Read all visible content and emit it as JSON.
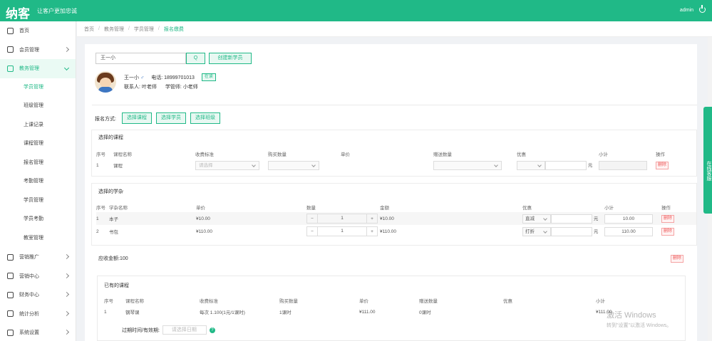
{
  "topbar": {
    "logo": "纳客",
    "slogan": "让客户更加忠诚",
    "user": "admin"
  },
  "sidebar": {
    "items": [
      {
        "label": "首页",
        "icon": "home-icon",
        "has_arrow": false
      },
      {
        "label": "会员管理",
        "icon": "member-icon",
        "has_arrow": true
      },
      {
        "label": "教务管理",
        "icon": "book-icon",
        "has_arrow": true,
        "active": true
      },
      {
        "label": "营销推广",
        "icon": "marketing-icon",
        "has_arrow": true
      },
      {
        "label": "营销中心",
        "icon": "center-icon",
        "has_arrow": true
      },
      {
        "label": "财务中心",
        "icon": "finance-icon",
        "has_arrow": true
      },
      {
        "label": "统计分析",
        "icon": "stats-icon",
        "has_arrow": true
      },
      {
        "label": "系统设置",
        "icon": "settings-icon",
        "has_arrow": true
      }
    ],
    "sub_items": [
      {
        "label": "学员管理",
        "active": true
      },
      {
        "label": "班级管理"
      },
      {
        "label": "上课记录"
      },
      {
        "label": "课程管理"
      },
      {
        "label": "报名管理"
      },
      {
        "label": "考勤管理"
      },
      {
        "label": "学员管理"
      },
      {
        "label": "学员考勤"
      },
      {
        "label": "教室管理"
      }
    ]
  },
  "breadcrumb": [
    "首页",
    "教务管理",
    "学员管理",
    "报名缴费"
  ],
  "search": {
    "value": "王一小",
    "button": "Q",
    "new_button": "创建新学员"
  },
  "student": {
    "name": "王一小",
    "gender_symbol": "♂",
    "phone_label": "电话",
    "phone": "18999701013",
    "status": "在读",
    "contact_label": "联系人",
    "contact": "叶老师",
    "school_label": "学管师",
    "school": "小老师"
  },
  "enroll_way": {
    "label": "报名方式",
    "buttons": [
      "选择课程",
      "选择学员",
      "选择班级"
    ]
  },
  "course_table": {
    "title": "选择的课程",
    "headers": [
      "序号",
      "课程名称",
      "收费标准",
      "购买数量",
      "单价",
      "赠送数量",
      "优惠",
      "小计",
      "操作"
    ],
    "rows": [
      {
        "no": "1",
        "name": "课程",
        "fee_placeholder": "请选择",
        "unit": "元",
        "action": "删除"
      }
    ]
  },
  "goods_table": {
    "title": "选择的学杂",
    "headers": [
      "序号",
      "学杂名称",
      "单价",
      "数量",
      "金额",
      "优惠",
      "小计",
      "操作"
    ],
    "rows": [
      {
        "no": "1",
        "name": "本子",
        "price": "¥10.00",
        "qty": "1",
        "amount": "¥10.00",
        "discount": "直减",
        "unit": "元",
        "subtotal": "10.00",
        "action": "删除"
      },
      {
        "no": "2",
        "name": "书包",
        "price": "¥110.00",
        "qty": "1",
        "amount": "¥110.00",
        "discount": "打折",
        "unit": "元",
        "subtotal": "110.00",
        "action": "删除"
      }
    ]
  },
  "total": {
    "label": "应收金额:",
    "value": "100",
    "delete": "删除"
  },
  "owned_courses": {
    "title": "已有的课程",
    "headers": [
      "序号",
      "课程名称",
      "收费标准",
      "购买数量",
      "单价",
      "赠送数量",
      "优惠",
      "小计"
    ],
    "rows": [
      {
        "no": "1",
        "name": "钢琴课",
        "fee": "每次 1.100(1元/1课时)",
        "qty": "1课时",
        "price": "¥111.00",
        "gift": "0课时",
        "discount": "",
        "subtotal": "¥111.00"
      }
    ],
    "date_label": "过期时间/有效期:",
    "date_placeholder": "请选择日期"
  },
  "watermark": {
    "line1": "激活 Windows",
    "line2": "转到\"设置\"以激活 Windows。"
  },
  "right_tab": "在线客服",
  "colors": {
    "brand": "#20b987",
    "danger": "#e55555"
  }
}
